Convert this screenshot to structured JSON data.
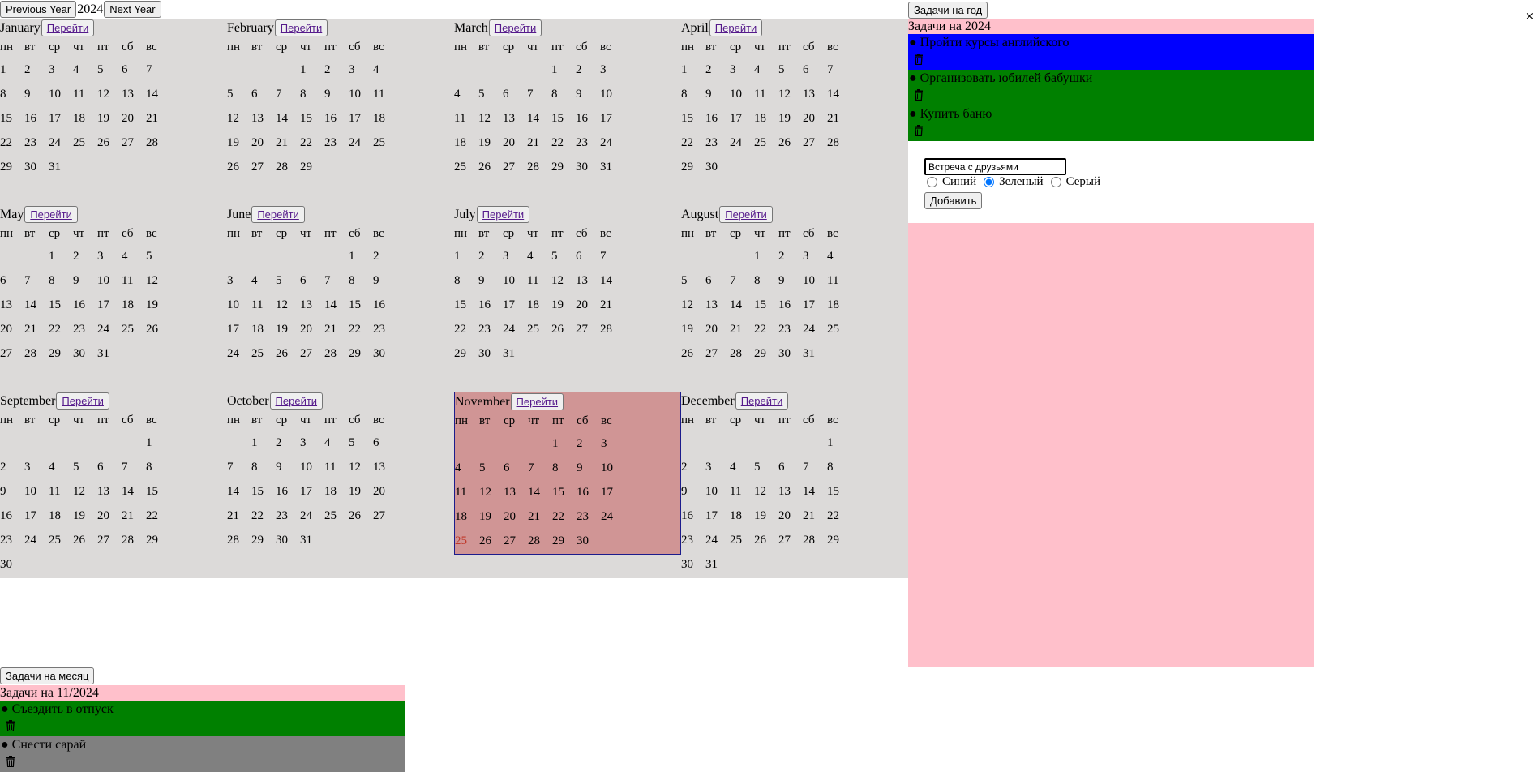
{
  "nav": {
    "prev_label": "Previous Year",
    "year": "2024",
    "next_label": "Next Year"
  },
  "year_tasks_button": "Задачи на год",
  "close_label": "×",
  "go_label": "Перейти",
  "weekdays": [
    "пн",
    "вт",
    "ср",
    "чт",
    "пт",
    "сб",
    "вс"
  ],
  "months": [
    {
      "name": "January",
      "offset": 0,
      "days": 31
    },
    {
      "name": "February",
      "offset": 3,
      "days": 29
    },
    {
      "name": "March",
      "offset": 4,
      "days": 31
    },
    {
      "name": "April",
      "offset": 0,
      "days": 30
    },
    {
      "name": "May",
      "offset": 2,
      "days": 31
    },
    {
      "name": "June",
      "offset": 5,
      "days": 30
    },
    {
      "name": "July",
      "offset": 0,
      "days": 31
    },
    {
      "name": "August",
      "offset": 3,
      "days": 31
    },
    {
      "name": "September",
      "offset": 6,
      "days": 30
    },
    {
      "name": "October",
      "offset": 1,
      "days": 31
    },
    {
      "name": "November",
      "offset": 4,
      "days": 30,
      "selected": true,
      "today": 25
    },
    {
      "name": "December",
      "offset": 6,
      "days": 31
    }
  ],
  "year_panel": {
    "title": "Задачи на 2024",
    "tasks": [
      {
        "text": "Пройти курсы английского",
        "color": "#0000ff"
      },
      {
        "text": "Организовать юбилей бабушки",
        "color": "#008000"
      },
      {
        "text": "Купить баню",
        "color": "#008000"
      }
    ],
    "form": {
      "input_value": "Встреча с друзьями",
      "options": [
        {
          "label": "Синий",
          "checked": false
        },
        {
          "label": "Зеленый",
          "checked": true
        },
        {
          "label": "Серый",
          "checked": false
        }
      ],
      "add_label": "Добавить"
    }
  },
  "month_tasks_button": "Задачи на месяц",
  "month_panel": {
    "title": "Задачи на 11/2024",
    "tasks": [
      {
        "text": "Съездить в отпуск",
        "color": "#008000"
      },
      {
        "text": "Снести сарай",
        "color": "#808080"
      }
    ]
  },
  "colors": {
    "calendar_bg": "#dcdad9",
    "selected_bg": "#d09595",
    "panel_bg": "#ffc0cb",
    "today": "#c0392b"
  }
}
